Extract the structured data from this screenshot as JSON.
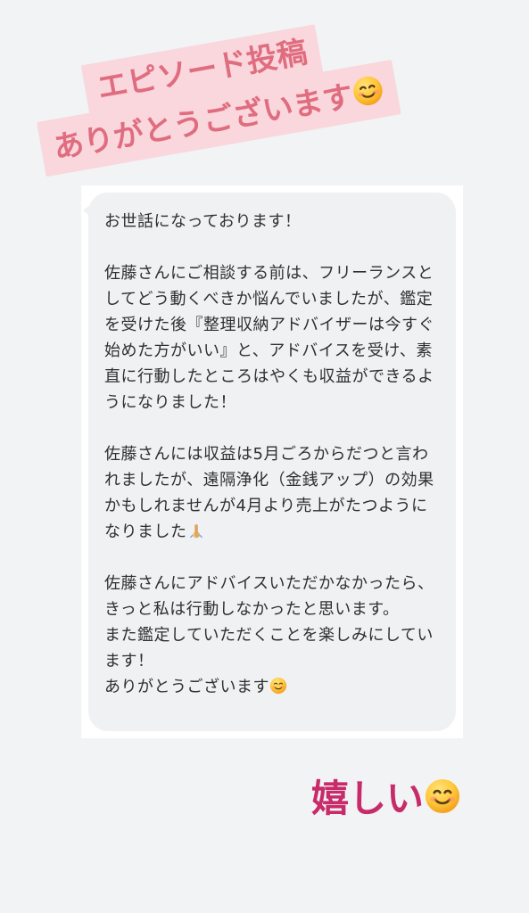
{
  "sticker": {
    "line1": "エピソード投稿",
    "line2": "ありがとうございます"
  },
  "message": {
    "p1": "お世話になっております！",
    "p2": "佐藤さんにご相談する前は、フリーランスとしてどう動くべきか悩んでいましたが、鑑定を受けた後『整理収納アドバイザーは今すぐ始めた方がいい』と、アドバイスを受け、素直に行動したところはやくも収益ができるようになりました！",
    "p3": "佐藤さんには収益は5月ごろからだつと言われましたが、遠隔浄化（金銭アップ）の効果かもしれませんが4月より売上がたつようになりました",
    "p4": "佐藤さんにアドバイスいただかなかったら、きっと私は行動しなかったと思います。",
    "p5": "また鑑定していただくことを楽しみにしています！",
    "p6": "ありがとうございます"
  },
  "footer": {
    "happy": "嬉しい"
  },
  "icons": {
    "smile": "smiling-face-icon",
    "pray": "folded-hands-icon"
  },
  "colors": {
    "background": "#f2f3f5",
    "sticker_bg": "#f9d7dd",
    "sticker_text": "#e06d7f",
    "bubble_bg": "#f0f1f3",
    "happy_text": "#c72b6a"
  }
}
